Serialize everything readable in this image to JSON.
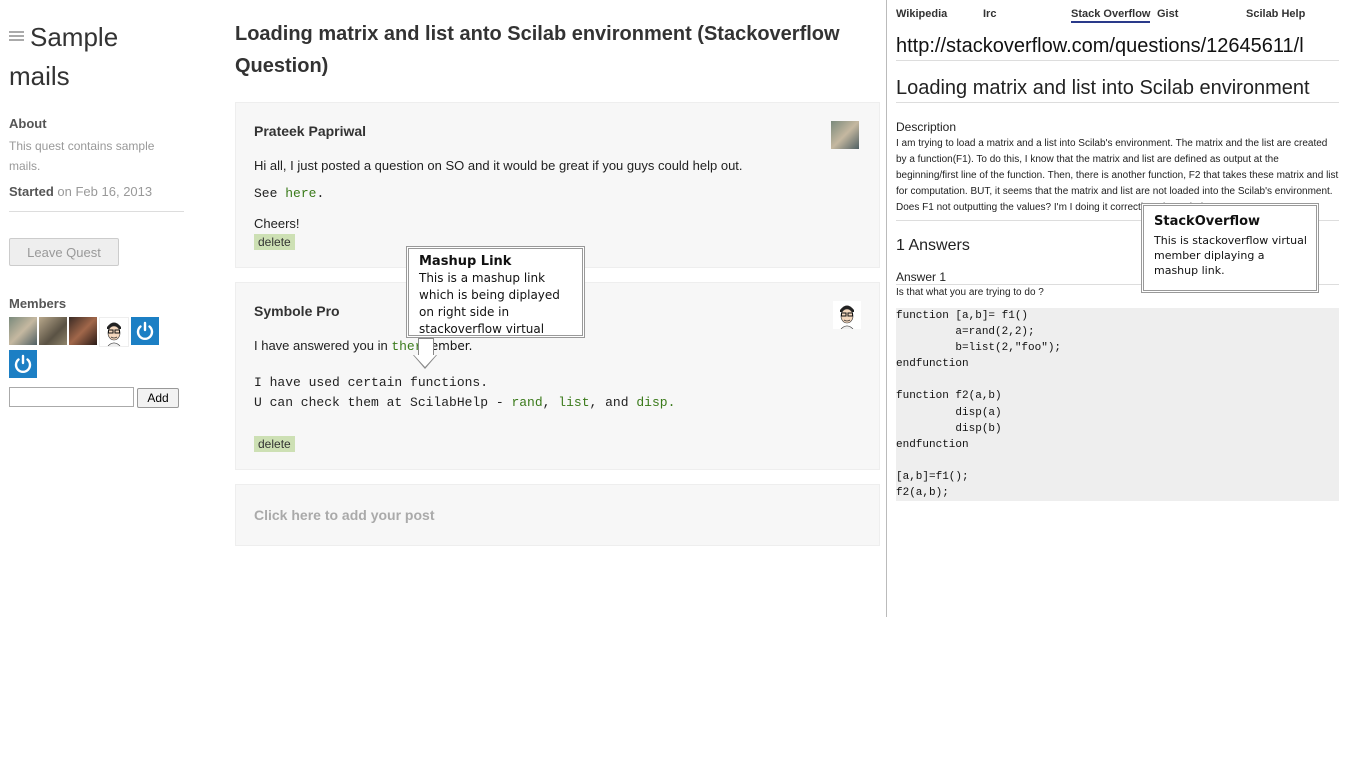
{
  "sidebar": {
    "quest_title": "Sample mails",
    "about_label": "About",
    "about_text": "This quest contains sample mails.",
    "started_label": "Started",
    "started_text": "on Feb 16, 2013",
    "leave_button": "Leave Quest",
    "members_label": "Members",
    "add_button": "Add",
    "add_input_value": ""
  },
  "main": {
    "title": "Loading matrix and list anto Scilab environment (Stackoverflow Question)",
    "posts": [
      {
        "author": "Prateek Papriwal",
        "line1": "Hi all, I just posted a question on SO and it would be great if you guys could help out.",
        "see": "See",
        "see_link": "here",
        "see_end": ".",
        "cheers": "Cheers!",
        "delete": "delete"
      },
      {
        "author": "Symbole Pro",
        "line1_pre": "I have answered you in",
        "line1_link": "there",
        "line1_end": ".",
        "line2": "I have used certain functions.",
        "line3_pre": "U can check them at ScilabHelp -",
        "link_rand": "rand",
        "comma": ",",
        "link_list": "list",
        "and": ", and",
        "link_disp": "disp",
        "period": ".",
        "delete": "delete"
      }
    ],
    "add_post": "Click here to add your post"
  },
  "callouts": {
    "mashup": {
      "title": "Mashup Link",
      "text": "This is a mashup link which is being diplayed on right side in stackoverflow virtual member."
    },
    "stackoverflow": {
      "title": "StackOverflow",
      "text": "This is stackoverflow virtual member diplaying a mashup link."
    }
  },
  "right": {
    "tabs": [
      "Wikipedia",
      "Irc",
      "Stack Overflow",
      "Gist",
      "Scilab Help"
    ],
    "active_tab": "Stack Overflow",
    "url": "http://stackoverflow.com/questions/12645611/l",
    "title": "Loading matrix and list into Scilab environment",
    "description_label": "Description",
    "description": "I am trying to load a matrix and a list into Scilab's environment. The matrix and the list are created by a function(F1). To do this, I know that the matrix and list are defined as output at the beginning/first line of the function. Then, there is another function, F2 that takes these matrix and list for computation. BUT, it seems that the matrix and list are not loaded into the Scilab's environment. Does F1 not outputting the values? I'm I doing it correctly? Please help me out.",
    "answers_count": "1 Answers",
    "answer_label": "Answer 1",
    "answer_text": "Is that what you are trying to do ?",
    "code": "function [a,b]= f1()\n         a=rand(2,2);\n         b=list(2,\"foo\");\nendfunction\n\nfunction f2(a,b)\n         disp(a)\n         disp(b)\nendfunction\n\n[a,b]=f1();\nf2(a,b);"
  },
  "colors": {
    "link_green": "#3a7a1a",
    "delete_bg": "#cde0b4",
    "post_bg": "#f7f7f7",
    "power_blue": "#1c7fc4",
    "tab_underline": "#2a3a8a"
  },
  "icons": [
    "menu-icon",
    "power-icon"
  ]
}
